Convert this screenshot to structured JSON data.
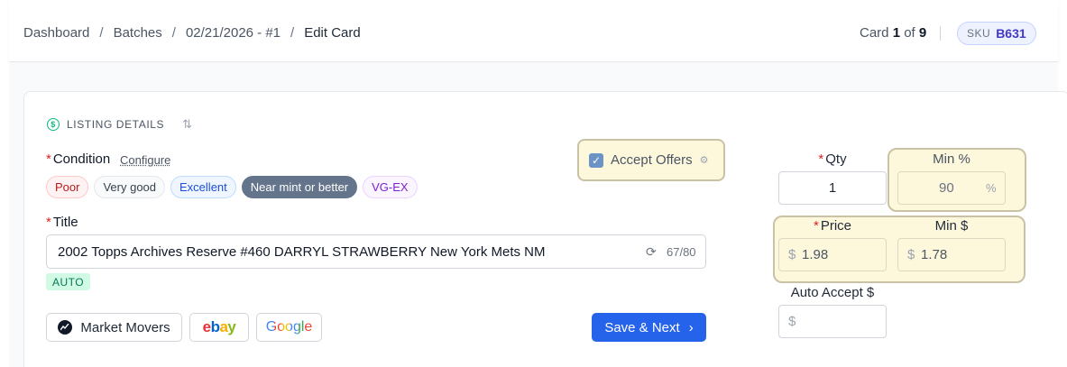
{
  "breadcrumb": {
    "items": [
      "Dashboard",
      "Batches",
      "02/21/2026 - #1"
    ],
    "current": "Edit Card",
    "separator": "/"
  },
  "card_position": {
    "prefix": "Card",
    "current": "1",
    "of_word": "of",
    "total": "9"
  },
  "sku": {
    "key": "SKU",
    "value": "B631"
  },
  "section": {
    "title": "LISTING DETAILS"
  },
  "condition": {
    "label": "Condition",
    "configure": "Configure",
    "options": [
      "Poor",
      "Very good",
      "Excellent",
      "Near mint or better",
      "VG-EX"
    ],
    "selected": "Near mint or better"
  },
  "accept_offers": {
    "label": "Accept Offers",
    "checked": true
  },
  "title_field": {
    "label": "Title",
    "value": "2002 Topps Archives Reserve #460 DARRYL STRAWBERRY New York Mets NM",
    "count": "67/80",
    "badge": "AUTO"
  },
  "buttons": {
    "market_movers": "Market Movers",
    "ebay_e": "e",
    "ebay_b": "b",
    "ebay_a": "a",
    "ebay_y": "y",
    "google": "Google",
    "save_next": "Save & Next"
  },
  "qty": {
    "label": "Qty",
    "value": "1"
  },
  "min_pct": {
    "label": "Min %",
    "value": "90",
    "unit": "%"
  },
  "price": {
    "label": "Price",
    "currency": "$",
    "value": "1.98"
  },
  "min_dollar": {
    "label": "Min $",
    "currency": "$",
    "value": "1.78"
  },
  "auto_accept": {
    "label": "Auto Accept $",
    "currency": "$",
    "value": ""
  },
  "colors": {
    "primary": "#2563eb",
    "highlight": "#fdf8dc",
    "required": "#dc2626"
  },
  "icons": [
    "dollar-circle-icon",
    "sort-icon",
    "gear-icon",
    "refresh-icon",
    "chevron-right-icon",
    "check-icon"
  ]
}
